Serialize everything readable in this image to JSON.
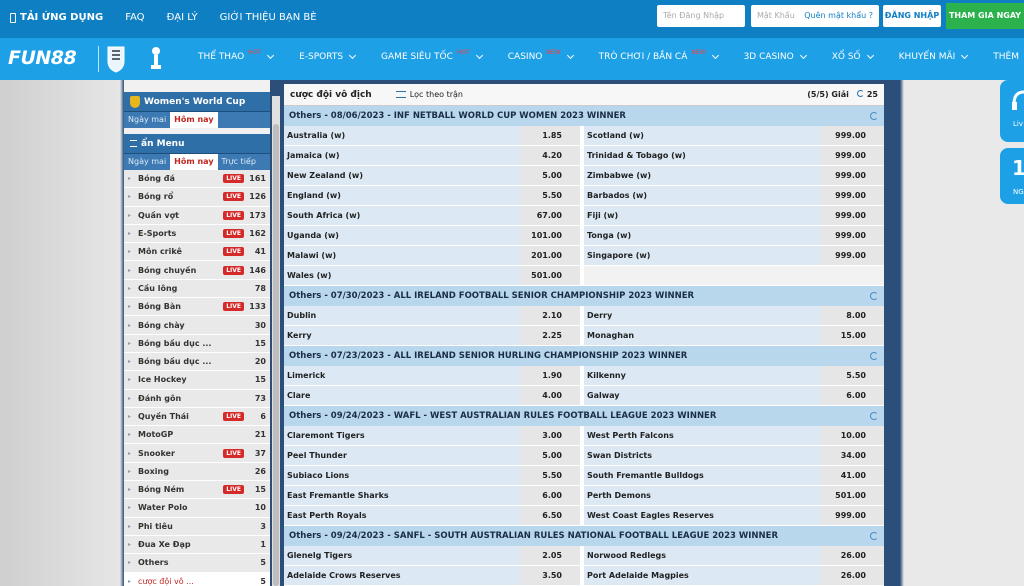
{
  "topbar": {
    "links": [
      "TẢI ỨNG DỤNG",
      "FAQ",
      "ĐẠI LÝ",
      "GIỚI THIỆU BẠN BÈ"
    ],
    "username_placeholder": "Tên Đăng Nhập",
    "password_placeholder": "Mật Khẩu",
    "forgot_label": "Quên mật khẩu ?",
    "login_label": "ĐĂNG NHẬP",
    "join_label": "THAM GIA NGAY"
  },
  "nav": {
    "logo": "FUN88",
    "items": [
      {
        "label": "THỂ THAO",
        "badge": "HOT"
      },
      {
        "label": "E-SPORTS",
        "badge": ""
      },
      {
        "label": "GAME SIÊU TỐC",
        "badge": "HOT"
      },
      {
        "label": "CASINO",
        "badge": "NEW"
      },
      {
        "label": "TRÒ CHƠI / BẮN CÁ",
        "badge": "NEW"
      },
      {
        "label": "3D CASINO",
        "badge": ""
      },
      {
        "label": "XỔ SỐ",
        "badge": ""
      },
      {
        "label": "KHUYẾN MÃI",
        "badge": ""
      },
      {
        "label": "THÊM",
        "badge": ""
      }
    ]
  },
  "float": {
    "item1_text": "Liv",
    "item2_big": "1",
    "item2_text": "NGÀ"
  },
  "sidebar": {
    "wwc_title": "Women's World Cup",
    "wwc_tabs": [
      "Ngày mai",
      "Hôm nay"
    ],
    "menu_title": "ẩn Menu",
    "menu_tabs": [
      "Ngày mai",
      "Hôm nay",
      "Trực tiếp"
    ],
    "live_label": "LIVE",
    "sports": [
      {
        "name": "Bóng đá",
        "live": true,
        "count": "161"
      },
      {
        "name": "Bóng rổ",
        "live": true,
        "count": "126"
      },
      {
        "name": "Quần vợt",
        "live": true,
        "count": "173"
      },
      {
        "name": "E-Sports",
        "live": true,
        "count": "162"
      },
      {
        "name": "Môn crikê",
        "live": true,
        "count": "41"
      },
      {
        "name": "Bóng chuyền",
        "live": true,
        "count": "146"
      },
      {
        "name": "Cầu lông",
        "live": false,
        "count": "78"
      },
      {
        "name": "Bóng Bàn",
        "live": true,
        "count": "133"
      },
      {
        "name": "Bóng chày",
        "live": false,
        "count": "30"
      },
      {
        "name": "Bóng bầu dục ...",
        "live": false,
        "count": "15"
      },
      {
        "name": "Bóng bầu dục ...",
        "live": false,
        "count": "20"
      },
      {
        "name": "Ice Hockey",
        "live": false,
        "count": "15"
      },
      {
        "name": "Đánh gôn",
        "live": false,
        "count": "73"
      },
      {
        "name": "Quyền Thái",
        "live": true,
        "count": "6"
      },
      {
        "name": "MotoGP",
        "live": false,
        "count": "21"
      },
      {
        "name": "Snooker",
        "live": true,
        "count": "37"
      },
      {
        "name": "Boxing",
        "live": false,
        "count": "26"
      },
      {
        "name": "Bóng Ném",
        "live": true,
        "count": "15"
      },
      {
        "name": "Water Polo",
        "live": false,
        "count": "10"
      },
      {
        "name": "Phi tiêu",
        "live": false,
        "count": "3"
      },
      {
        "name": "Đua Xe Đạp",
        "live": false,
        "count": "1"
      },
      {
        "name": "Others",
        "live": false,
        "count": "5"
      },
      {
        "name": "cược đội vô ...",
        "live": false,
        "count": "5",
        "current": true
      }
    ]
  },
  "main": {
    "title": "cược đội vô địch",
    "filter_label": "Lọc theo trận",
    "league_count": "(5/5) Giải",
    "refresh_count": "25",
    "sections": [
      {
        "header": "Others - 08/06/2023 - INF NETBALL WORLD CUP WOMEN 2023 WINNER",
        "rows": [
          [
            "Australia (w)",
            "1.85",
            "Scotland (w)",
            "999.00"
          ],
          [
            "Jamaica (w)",
            "4.20",
            "Trinidad & Tobago (w)",
            "999.00"
          ],
          [
            "New Zealand (w)",
            "5.00",
            "Zimbabwe (w)",
            "999.00"
          ],
          [
            "England (w)",
            "5.50",
            "Barbados (w)",
            "999.00"
          ],
          [
            "South Africa (w)",
            "67.00",
            "Fiji (w)",
            "999.00"
          ],
          [
            "Uganda (w)",
            "101.00",
            "Tonga (w)",
            "999.00"
          ],
          [
            "Malawi (w)",
            "201.00",
            "Singapore (w)",
            "999.00"
          ],
          [
            "Wales (w)",
            "501.00",
            "",
            ""
          ]
        ]
      },
      {
        "header": "Others - 07/30/2023 - ALL IRELAND FOOTBALL SENIOR CHAMPIONSHIP 2023 WINNER",
        "rows": [
          [
            "Dublin",
            "2.10",
            "Derry",
            "8.00"
          ],
          [
            "Kerry",
            "2.25",
            "Monaghan",
            "15.00"
          ]
        ]
      },
      {
        "header": "Others - 07/23/2023 - ALL IRELAND SENIOR HURLING CHAMPIONSHIP 2023 WINNER",
        "rows": [
          [
            "Limerick",
            "1.90",
            "Kilkenny",
            "5.50"
          ],
          [
            "Clare",
            "4.00",
            "Galway",
            "6.00"
          ]
        ]
      },
      {
        "header": "Others - 09/24/2023 - WAFL - WEST AUSTRALIAN RULES FOOTBALL LEAGUE 2023 WINNER",
        "rows": [
          [
            "Claremont Tigers",
            "3.00",
            "West Perth Falcons",
            "10.00"
          ],
          [
            "Peel Thunder",
            "5.00",
            "Swan Districts",
            "34.00"
          ],
          [
            "Subiaco Lions",
            "5.50",
            "South Fremantle Bulldogs",
            "41.00"
          ],
          [
            "East Fremantle Sharks",
            "6.00",
            "Perth Demons",
            "501.00"
          ],
          [
            "East Perth Royals",
            "6.50",
            "West Coast Eagles Reserves",
            "999.00"
          ]
        ]
      },
      {
        "header": "Others - 09/24/2023 - SANFL - SOUTH AUSTRALIAN RULES NATIONAL FOOTBALL LEAGUE 2023 WINNER",
        "rows": [
          [
            "Glenelg Tigers",
            "2.05",
            "Norwood Redlegs",
            "26.00"
          ],
          [
            "Adelaide Crows Reserves",
            "3.50",
            "Port Adelaide Magpies",
            "26.00"
          ]
        ]
      }
    ]
  }
}
